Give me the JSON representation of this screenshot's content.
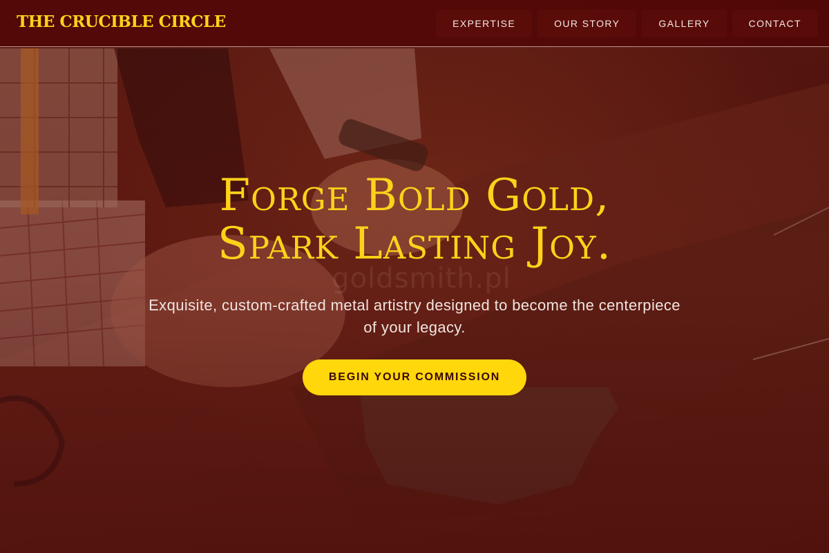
{
  "brand": {
    "name": "THE CRUCIBLE CIRCLE"
  },
  "nav": {
    "items": [
      {
        "label": "EXPERTISE"
      },
      {
        "label": "OUR STORY"
      },
      {
        "label": "GALLERY"
      },
      {
        "label": "CONTACT"
      }
    ]
  },
  "hero": {
    "title_line1": "Forge Bold Gold,",
    "title_line2": "Spark Lasting Joy.",
    "subtitle": "Exquisite, custom-crafted metal artistry designed to become the centerpiece of your legacy.",
    "cta_label": "BEGIN YOUR COMMISSION",
    "watermark": "goldsmith.pl"
  },
  "colors": {
    "accent": "#ffd21a",
    "nav_bg": "#500606",
    "cta_text": "#3a0808"
  }
}
